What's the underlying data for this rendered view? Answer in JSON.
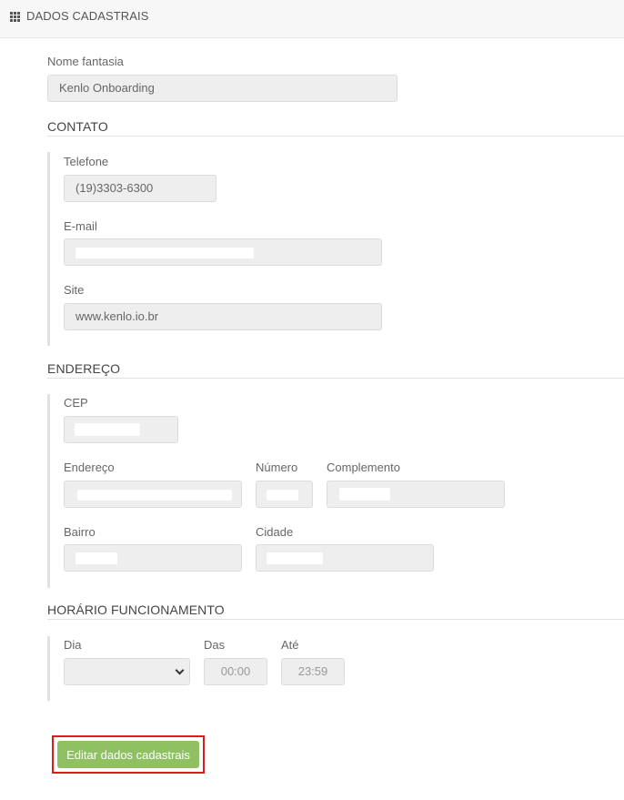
{
  "header": {
    "title": "DADOS CADASTRAIS",
    "icon": "grid-icon"
  },
  "nome_fantasia": {
    "label": "Nome fantasia",
    "value": "Kenlo Onboarding"
  },
  "contato": {
    "title": "CONTATO",
    "telefone": {
      "label": "Telefone",
      "value": "(19)3303-6300"
    },
    "email": {
      "label": "E-mail",
      "value": ""
    },
    "site": {
      "label": "Site",
      "value": "www.kenlo.io.br"
    }
  },
  "endereco": {
    "title": "ENDEREÇO",
    "cep": {
      "label": "CEP",
      "value": ""
    },
    "endereco": {
      "label": "Endereço",
      "value": ""
    },
    "numero": {
      "label": "Número",
      "value": ""
    },
    "complemento": {
      "label": "Complemento",
      "value": ""
    },
    "bairro": {
      "label": "Bairro",
      "value": ""
    },
    "cidade": {
      "label": "Cidade",
      "value": ""
    }
  },
  "horario": {
    "title": "HORÁRIO FUNCIONAMENTO",
    "dia": {
      "label": "Dia",
      "value": ""
    },
    "das": {
      "label": "Das",
      "value": "00:00"
    },
    "ate": {
      "label": "Até",
      "value": "23:59"
    }
  },
  "actions": {
    "edit_label": "Editar dados cadastrais"
  },
  "colors": {
    "accent_button": "#8fc163",
    "highlight_border": "#dd1d1d",
    "field_bg": "#eeeeee"
  }
}
